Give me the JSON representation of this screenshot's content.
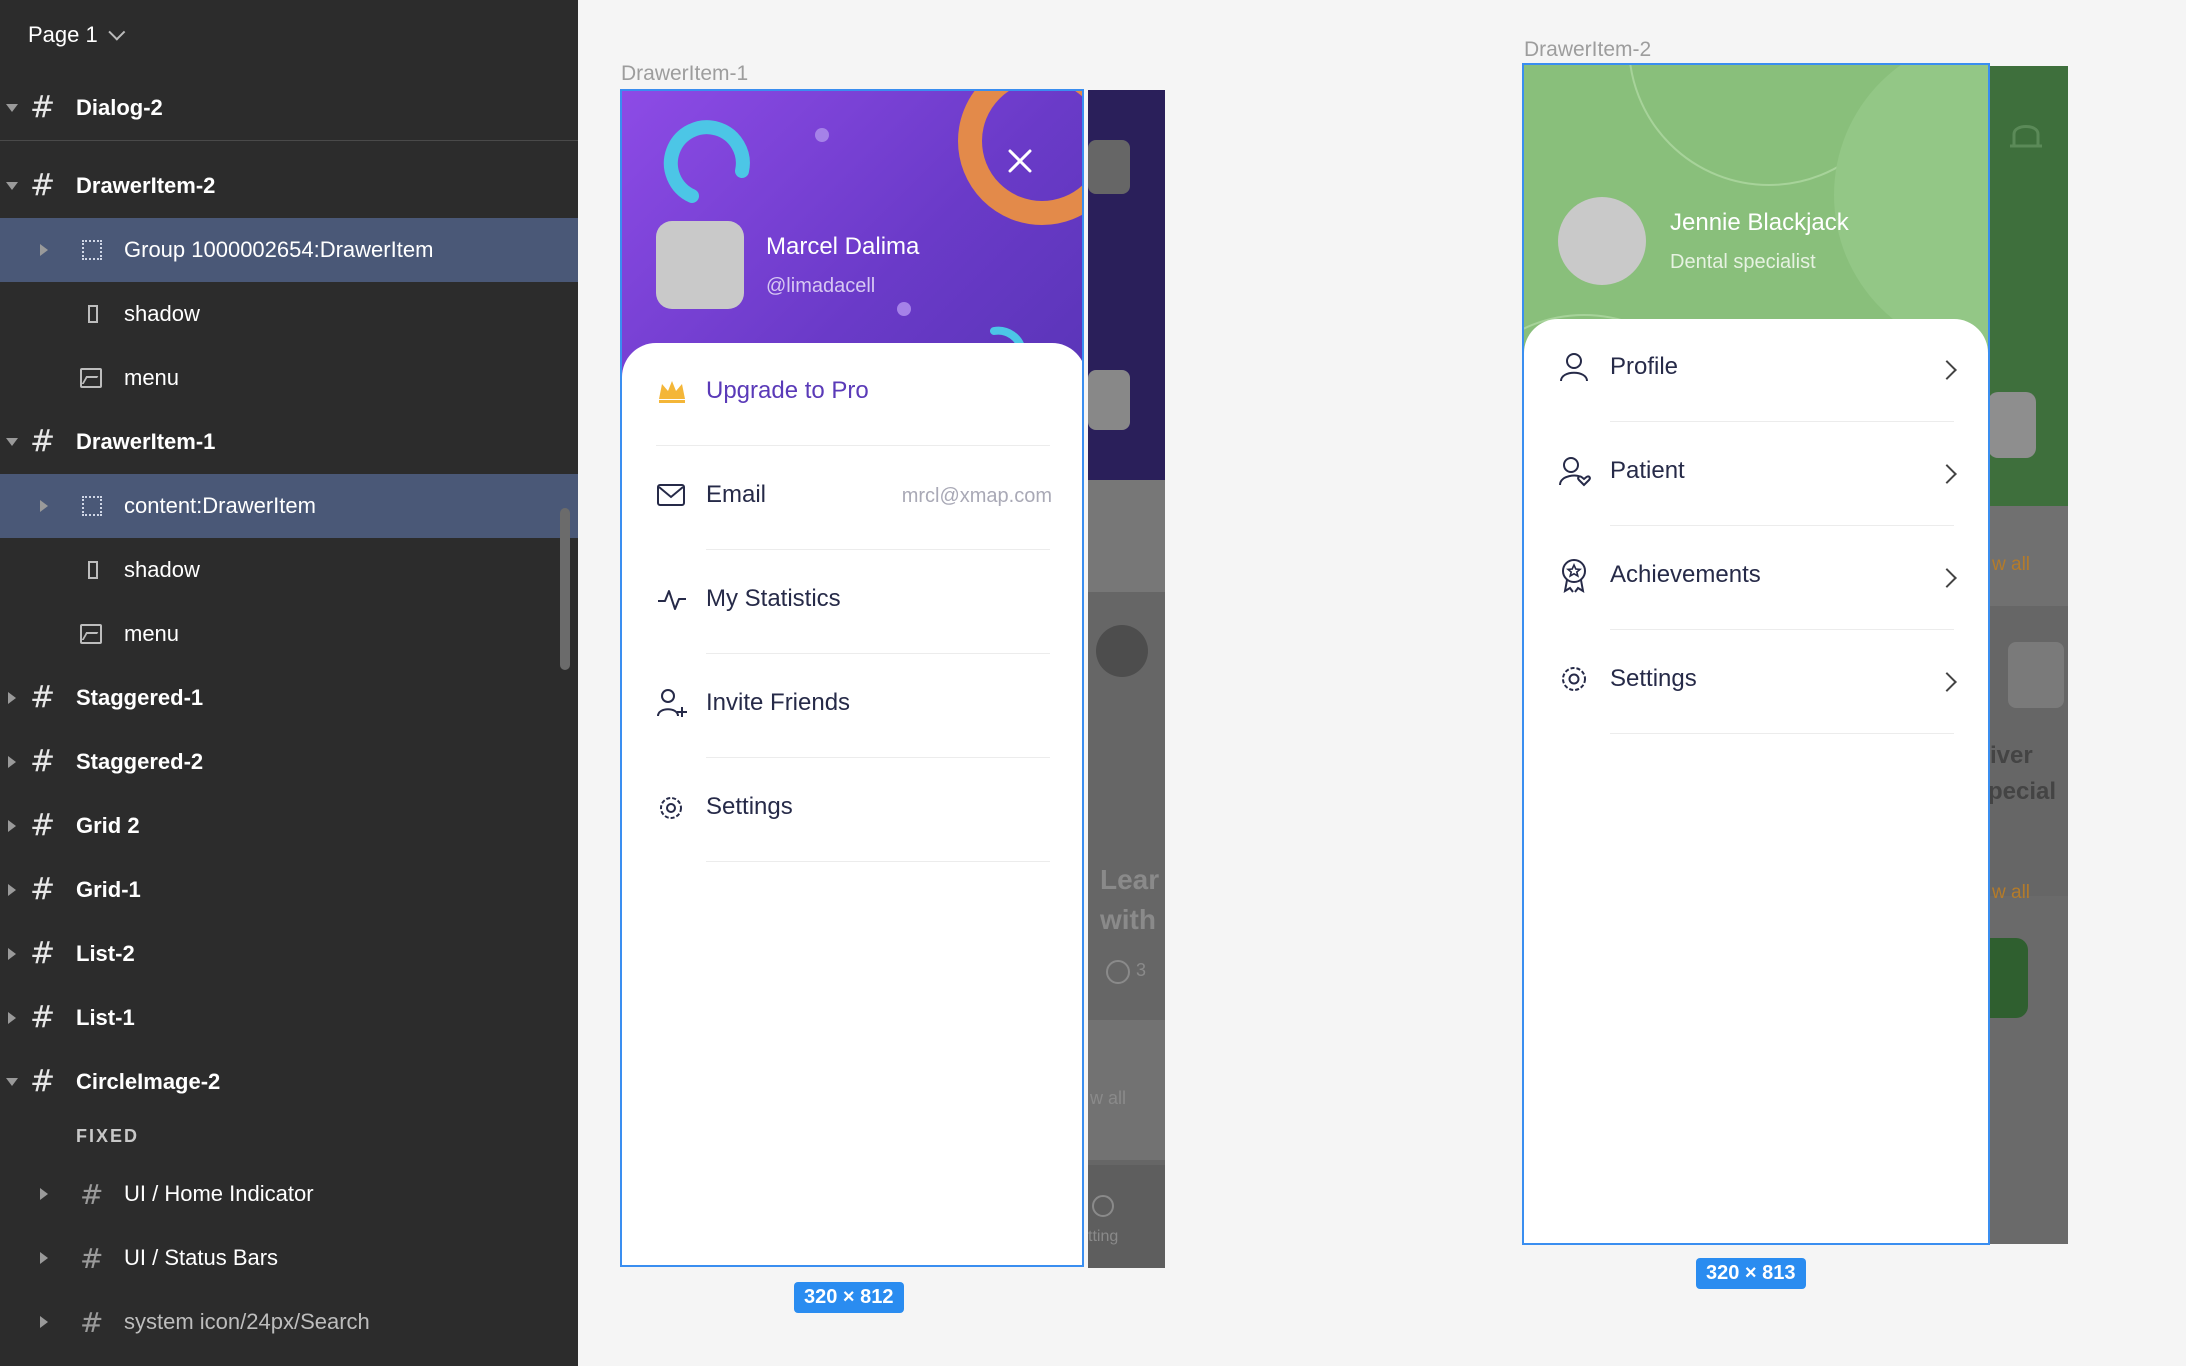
{
  "layers": {
    "page_selector": "Page 1",
    "rows": [
      {
        "label": "Dialog-2"
      },
      {
        "label": "DrawerItem-2"
      },
      {
        "label": "Group 1000002654:DrawerItem"
      },
      {
        "label": "shadow"
      },
      {
        "label": "menu"
      },
      {
        "label": "DrawerItem-1"
      },
      {
        "label": "content:DrawerItem"
      },
      {
        "label": "shadow"
      },
      {
        "label": "menu"
      },
      {
        "label": "Staggered-1"
      },
      {
        "label": "Staggered-2"
      },
      {
        "label": "Grid 2"
      },
      {
        "label": "Grid-1"
      },
      {
        "label": "List-2"
      },
      {
        "label": "List-1"
      },
      {
        "label": "CircleImage-2"
      }
    ],
    "fixed_section_label": "FIXED",
    "fixed_rows": [
      {
        "label": "UI / Home Indicator"
      },
      {
        "label": "UI / Status Bars"
      },
      {
        "label": "system icon/24px/Search"
      }
    ]
  },
  "drawer1": {
    "frame_title": "DrawerItem-1",
    "size_badge": "320 × 812",
    "name": "Marcel Dalima",
    "handle": "@limadacell",
    "items": [
      {
        "label": "Upgrade to Pro",
        "icon": "crown-icon",
        "value": ""
      },
      {
        "label": "Email",
        "icon": "mail-icon",
        "value": "mrcl@xmap.com"
      },
      {
        "label": "My Statistics",
        "icon": "activity-icon",
        "value": ""
      },
      {
        "label": "Invite Friends",
        "icon": "user-plus-icon",
        "value": ""
      },
      {
        "label": "Settings",
        "icon": "gear-icon",
        "value": ""
      }
    ],
    "background_texts": [
      "Lear",
      "with",
      "3",
      "w all",
      "tting"
    ],
    "colors": {
      "header": "#7b45d8",
      "accent": "#5a3ab8",
      "crown": "#f4b638",
      "orange": "#e38a4a",
      "cyan": "#4cc6e6"
    }
  },
  "drawer2": {
    "frame_title": "DrawerItem-2",
    "size_badge": "320 × 813",
    "name": "Jennie Blackjack",
    "subtitle": "Dental specialist",
    "items": [
      {
        "label": "Profile",
        "icon": "user-icon"
      },
      {
        "label": "Patient",
        "icon": "user-heart-icon"
      },
      {
        "label": "Achievements",
        "icon": "award-icon"
      },
      {
        "label": "Settings",
        "icon": "gear-icon"
      }
    ],
    "background_texts": [
      "w all",
      "iver",
      "pecial",
      "w all"
    ],
    "colors": {
      "header": "#89bf7b",
      "bg_app": "#3e6f3c"
    }
  }
}
